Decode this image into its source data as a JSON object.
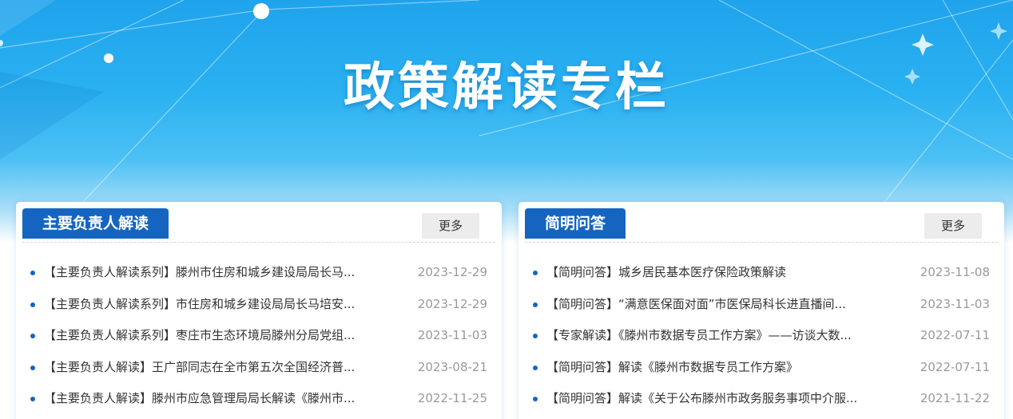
{
  "banner": {
    "title": "政策解读专栏"
  },
  "colors": {
    "accent": "#1565c0",
    "banner_blue": "#2ab1f1",
    "date_gray": "#999999"
  },
  "panels": [
    {
      "tag": "主要负责人解读",
      "more_label": "更多",
      "items": [
        {
          "title": "【主要负责人解读系列】滕州市住房和城乡建设局局长马...",
          "date": "2023-12-29"
        },
        {
          "title": "【主要负责人解读系列】市住房和城乡建设局局长马培安...",
          "date": "2023-12-29"
        },
        {
          "title": "【主要负责人解读系列】枣庄市生态环境局滕州分局党组...",
          "date": "2023-11-03"
        },
        {
          "title": "【主要负责人解读】王广部同志在全市第五次全国经济普...",
          "date": "2023-08-21"
        },
        {
          "title": "【主要负责人解读】滕州市应急管理局局长解读《滕州市...",
          "date": "2022-11-25"
        }
      ]
    },
    {
      "tag": "简明问答",
      "more_label": "更多",
      "items": [
        {
          "title": "【简明问答】城乡居民基本医疗保险政策解读",
          "date": "2023-11-08"
        },
        {
          "title": "【简明问答】“满意医保面对面”市医保局科长进直播间...",
          "date": "2023-11-03"
        },
        {
          "title": "【专家解读】《滕州市数据专员工作方案》——访谈大数...",
          "date": "2022-07-11"
        },
        {
          "title": "【简明问答】解读《滕州市数据专员工作方案》",
          "date": "2022-07-11"
        },
        {
          "title": "【简明问答】解读《关于公布滕州市政务服务事项中介服...",
          "date": "2021-11-22"
        }
      ]
    }
  ]
}
